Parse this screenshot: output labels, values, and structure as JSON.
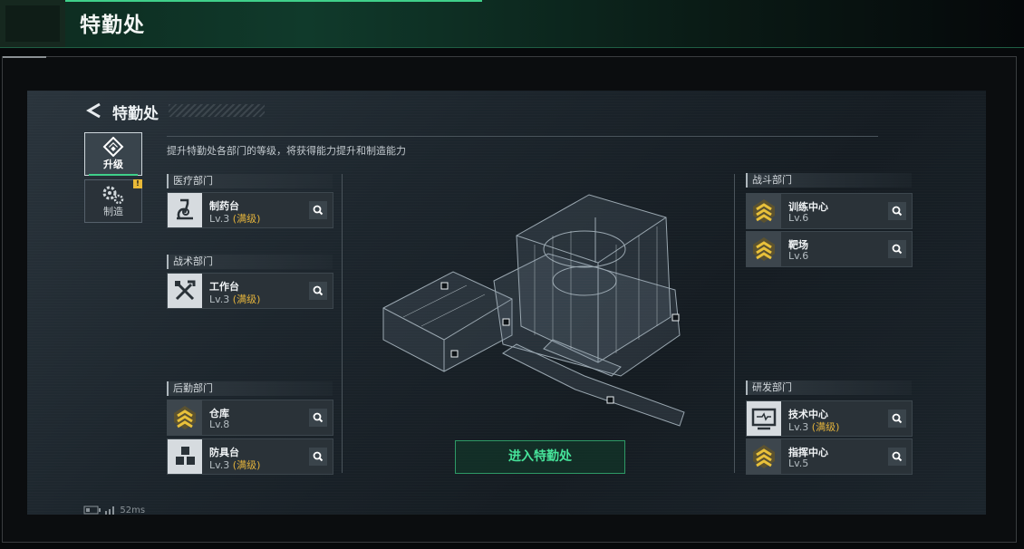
{
  "header": {
    "title": "特勤处"
  },
  "page": {
    "title": "特勤处",
    "description": "提升特勤处各部门的等级，将获得能力提升和制造能力"
  },
  "tabs": [
    {
      "label": "升级",
      "icon": "upgrade-icon",
      "active": true
    },
    {
      "label": "制造",
      "icon": "gears-icon",
      "badge": "!"
    }
  ],
  "departments": {
    "medical": {
      "title": "医疗部门",
      "items": [
        {
          "name": "制药台",
          "level": "Lv.3",
          "max": "(满级)",
          "icon": "microscope-icon"
        }
      ]
    },
    "tactical": {
      "title": "战术部门",
      "items": [
        {
          "name": "工作台",
          "level": "Lv.3",
          "max": "(满级)",
          "icon": "tools-icon"
        }
      ]
    },
    "logistics": {
      "title": "后勤部门",
      "items": [
        {
          "name": "仓库",
          "level": "Lv.8",
          "max": "",
          "icon": "rank-chevron-icon"
        },
        {
          "name": "防具台",
          "level": "Lv.3",
          "max": "(满级)",
          "icon": "cubes-icon"
        }
      ]
    },
    "combat": {
      "title": "战斗部门",
      "items": [
        {
          "name": "训练中心",
          "level": "Lv.6",
          "max": "",
          "icon": "rank-chevron-icon"
        },
        {
          "name": "靶场",
          "level": "Lv.6",
          "max": "",
          "icon": "rank-chevron-icon"
        }
      ]
    },
    "research": {
      "title": "研发部门",
      "items": [
        {
          "name": "技术中心",
          "level": "Lv.3",
          "max": "(满级)",
          "icon": "monitor-icon"
        },
        {
          "name": "指挥中心",
          "level": "Lv.5",
          "max": "",
          "icon": "rank-chevron-icon"
        }
      ]
    }
  },
  "enter_button": {
    "label": "进入特勤处"
  },
  "status": {
    "ping": "52ms"
  },
  "colors": {
    "accent": "#46e39a",
    "max_level": "#e2b23c",
    "rank_gold": "#e9c13a"
  }
}
